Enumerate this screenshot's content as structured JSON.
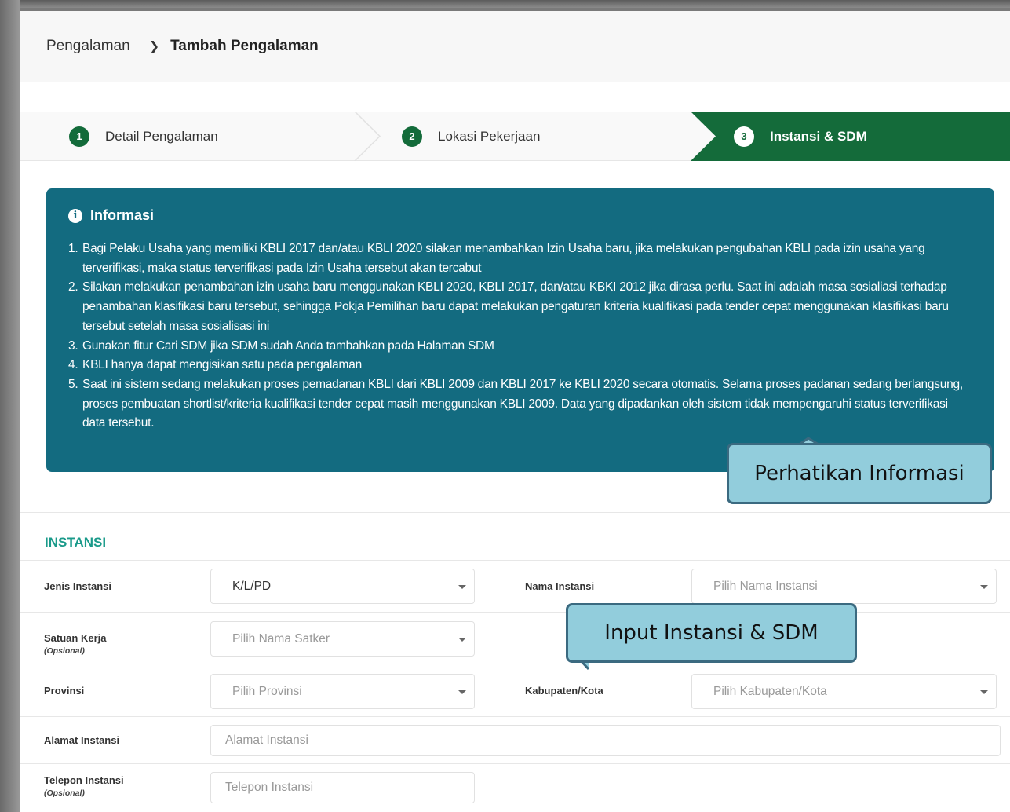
{
  "breadcrumb": {
    "parent": "Pengalaman",
    "separator": ">",
    "current": "Tambah Pengalaman"
  },
  "steps": [
    {
      "number": "1",
      "label": "Detail Pengalaman",
      "active": false
    },
    {
      "number": "2",
      "label": "Lokasi Pekerjaan",
      "active": false
    },
    {
      "number": "3",
      "label": "Instansi & SDM",
      "active": true
    }
  ],
  "info": {
    "icon": "info-icon",
    "title": "Informasi",
    "items": [
      "Bagi Pelaku Usaha yang memiliki KBLI 2017 dan/atau KBLI 2020 silakan menambahkan Izin Usaha baru, jika melakukan pengubahan KBLI pada izin usaha yang terverifikasi, maka status terverifikasi pada Izin Usaha tersebut akan tercabut",
      "Silakan melakukan penambahan izin usaha baru menggunakan KBLI 2020, KBLI 2017, dan/atau KBKI 2012 jika dirasa perlu. Saat ini adalah masa sosialiasi terhadap penambahan klasifikasi baru tersebut, sehingga Pokja Pemilihan baru dapat melakukan pengaturan kriteria kualifikasi pada tender cepat menggunakan klasifikasi baru tersebut setelah masa sosialisasi ini",
      "Gunakan fitur Cari SDM jika SDM sudah Anda tambahkan pada Halaman SDM",
      "KBLI hanya dapat mengisikan satu pada pengalaman",
      "Saat ini sistem sedang melakukan proses pemadanan KBLI dari KBLI 2009 dan KBLI 2017 ke KBLI 2020 secara otomatis. Selama proses padanan sedang berlangsung, proses pembuatan shortlist/kriteria kualifikasi tender cepat masih menggunakan KBLI 2009. Data yang dipadankan oleh sistem tidak mempengaruhi status terverifikasi data tersebut."
    ]
  },
  "callouts": {
    "info": "Perhatikan Informasi",
    "input": "Input Instansi & SDM"
  },
  "section": {
    "title": "INSTANSI"
  },
  "form": {
    "jenis_instansi": {
      "label": "Jenis Instansi",
      "value": "K/L/PD"
    },
    "nama_instansi": {
      "label": "Nama Instansi",
      "placeholder": "Pilih Nama Instansi"
    },
    "satuan_kerja": {
      "label": "Satuan Kerja",
      "optional": "(Opsional)",
      "placeholder": "Pilih Nama Satker"
    },
    "provinsi": {
      "label": "Provinsi",
      "placeholder": "Pilih Provinsi"
    },
    "kabupaten": {
      "label": "Kabupaten/Kota",
      "placeholder": "Pilih Kabupaten/Kota"
    },
    "alamat": {
      "label": "Alamat Instansi",
      "placeholder": "Alamat Instansi"
    },
    "telepon": {
      "label": "Telepon Instansi",
      "optional": "(Opsional)",
      "placeholder": "Telepon Instansi"
    }
  }
}
